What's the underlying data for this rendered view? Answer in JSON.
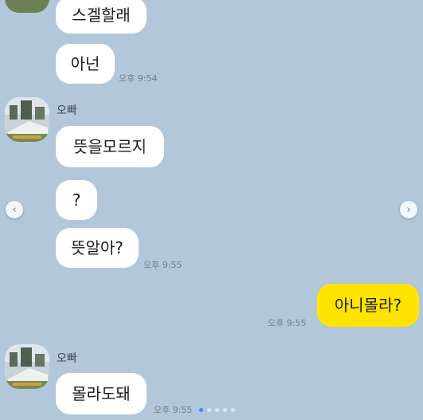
{
  "colors": {
    "background": "#b2c7da",
    "incoming_bubble": "#ffffff",
    "outgoing_bubble": "#fee500"
  },
  "messages": [
    {
      "text": "스겔할래"
    },
    {
      "text": "아넌",
      "time": "오후 9:54"
    },
    {
      "sender": "오빠",
      "text": "뜻을모르지"
    },
    {
      "text": "?"
    },
    {
      "text": "뜻알아?",
      "time": "오후 9:55"
    },
    {
      "text": "아니몰라?",
      "time": "오후 9:55"
    },
    {
      "sender": "오빠",
      "text": "몰라도돼",
      "time": "오후 9:55"
    }
  ],
  "carousel": {
    "prev_icon": "chevron-left-icon",
    "next_icon": "chevron-right-icon",
    "prev_glyph": "‹",
    "next_glyph": "›",
    "total_slides": 5,
    "active_slide": 1
  }
}
